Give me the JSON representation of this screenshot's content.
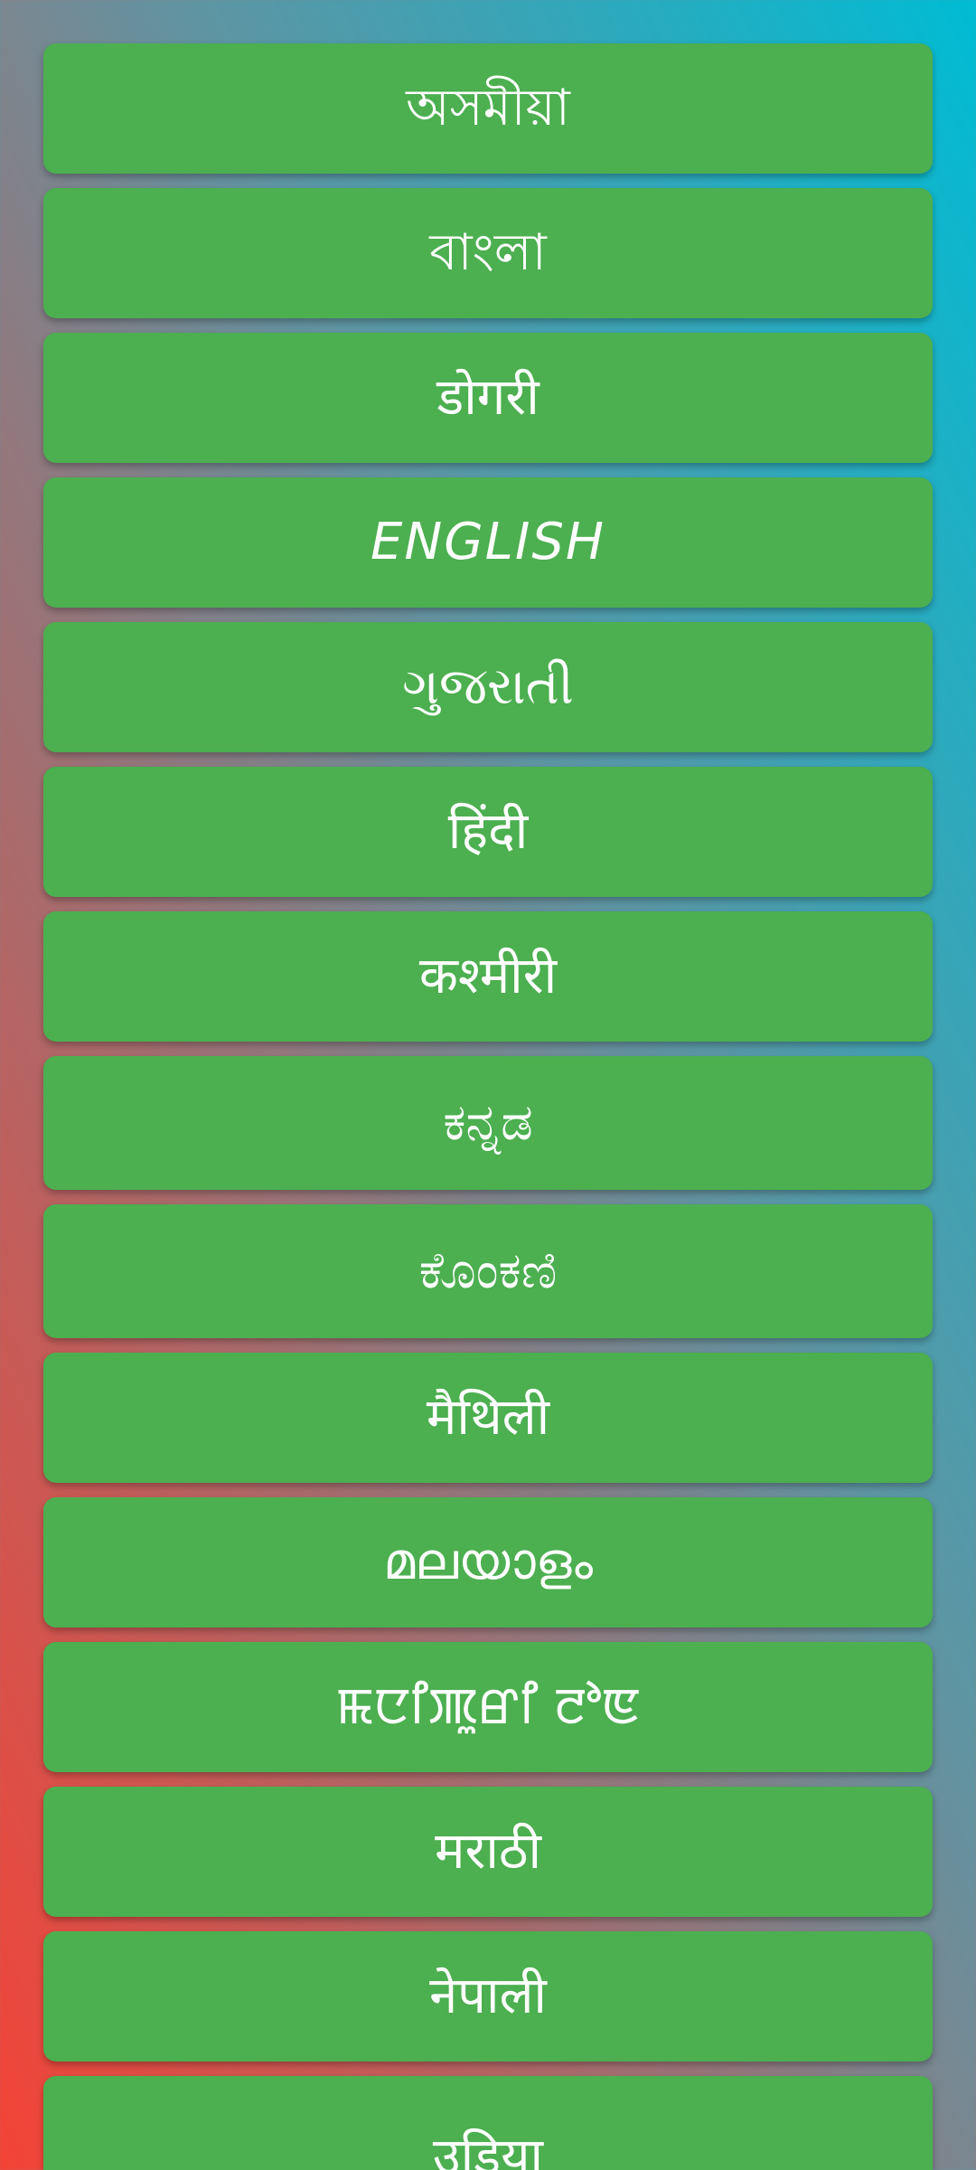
{
  "languages": [
    "অসমীয়া",
    "বাংলা",
    "डोगरी",
    "ENGLISH",
    "ગુજરાતી",
    "हिंदी",
    "कश्मीरी",
    "ಕನ್ನಡ",
    "ಕೊಂಕಣಿ",
    "मैथिली",
    "മലയാളം",
    "ꯃꯅꯤꯄꯨꯔꯤ ꯂꯣꯟ",
    "मराठी",
    "नेपाली",
    "उडिया"
  ],
  "colors": {
    "button": "#4caf50",
    "gradient_top": "#00bcd4",
    "gradient_bottom": "#f44336"
  }
}
